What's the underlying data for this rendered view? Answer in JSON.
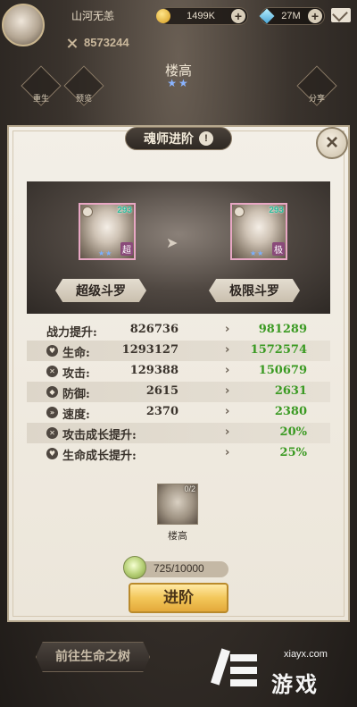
{
  "hud": {
    "player_name": "山河无恙",
    "power": "8573244",
    "coins": "1499K",
    "gems": "27M",
    "plus": "+"
  },
  "character": {
    "name": "楼高",
    "stars": "★★"
  },
  "side_buttons": {
    "left1": "重生",
    "left2": "预览",
    "right1": "分享"
  },
  "dialog": {
    "title": "魂师进阶",
    "info": "!",
    "close": "×"
  },
  "showcase": {
    "left": {
      "level": "293",
      "badge": "超",
      "rank": "超级斗罗",
      "stars": "★★"
    },
    "right": {
      "level": "293",
      "badge": "极",
      "rank": "极限斗罗",
      "stars": "★★"
    },
    "arrow": "➤"
  },
  "stats": [
    {
      "label": "战力提升:",
      "current": "826736",
      "next": "981289",
      "icon": ""
    },
    {
      "label": "生命:",
      "current": "1293127",
      "next": "1572574",
      "icon": "♥"
    },
    {
      "label": "攻击:",
      "current": "129388",
      "next": "150679",
      "icon": "✕"
    },
    {
      "label": "防御:",
      "current": "2615",
      "next": "2631",
      "icon": "◆"
    },
    {
      "label": "速度:",
      "current": "2370",
      "next": "2380",
      "icon": "»"
    },
    {
      "label": "攻击成长提升:",
      "current": "",
      "next": "20%",
      "icon": "✕"
    },
    {
      "label": "生命成长提升:",
      "current": "",
      "next": "25%",
      "icon": "♥"
    }
  ],
  "material": {
    "count": "0/2",
    "name": "楼高"
  },
  "cost": {
    "value": "725/10000"
  },
  "actions": {
    "advance": "进阶",
    "go_tree": "前往生命之树"
  },
  "watermark": {
    "url": "xiayx.com",
    "text": "游戏"
  }
}
